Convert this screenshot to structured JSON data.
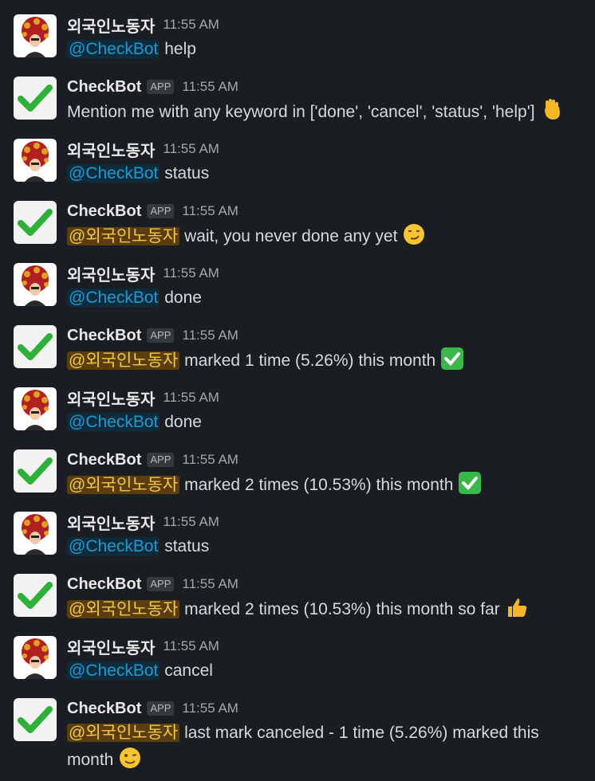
{
  "user_name": "외국인노동자",
  "bot_name": "CheckBot",
  "app_badge": "APP",
  "messages": [
    {
      "sender": "외국인노동자",
      "time": "11:55 AM",
      "mention": "@CheckBot",
      "text": " help",
      "emoji": ""
    },
    {
      "sender": "CheckBot",
      "time": "11:55 AM",
      "mention": "",
      "text": "Mention me with any keyword in ['done', 'cancel', 'status', 'help']",
      "emoji": "waving-hand-icon"
    },
    {
      "sender": "외국인노동자",
      "time": "11:55 AM",
      "mention": "@CheckBot",
      "text": " status",
      "emoji": ""
    },
    {
      "sender": "CheckBot",
      "time": "11:55 AM",
      "mention": "@외국인노동자",
      "text": " wait, you never done any yet",
      "emoji": "smirking-face-icon"
    },
    {
      "sender": "외국인노동자",
      "time": "11:55 AM",
      "mention": "@CheckBot",
      "text": " done",
      "emoji": ""
    },
    {
      "sender": "CheckBot",
      "time": "11:55 AM",
      "mention": "@외국인노동자",
      "text": " marked 1 time (5.26%) this month",
      "emoji": "check-mark-button-icon"
    },
    {
      "sender": "외국인노동자",
      "time": "11:55 AM",
      "mention": "@CheckBot",
      "text": " done",
      "emoji": ""
    },
    {
      "sender": "CheckBot",
      "time": "11:55 AM",
      "mention": "@외국인노동자",
      "text": " marked 2 times (10.53%) this month",
      "emoji": "check-mark-button-icon"
    },
    {
      "sender": "외국인노동자",
      "time": "11:55 AM",
      "mention": "@CheckBot",
      "text": " status",
      "emoji": ""
    },
    {
      "sender": "CheckBot",
      "time": "11:55 AM",
      "mention": "@외국인노동자",
      "text": " marked 2 times (10.53%) this month so far",
      "emoji": "thumbs-up-icon"
    },
    {
      "sender": "외국인노동자",
      "time": "11:55 AM",
      "mention": "@CheckBot",
      "text": " cancel",
      "emoji": ""
    },
    {
      "sender": "CheckBot",
      "time": "11:55 AM",
      "mention": "@외국인노동자",
      "text": " last mark canceled - 1 time (5.26%) marked this month",
      "emoji": "winking-face-icon"
    }
  ],
  "colors": {
    "background": "#1a1d21",
    "bot_mention": "#1d9bd1",
    "user_mention": "#f2c744",
    "check_green": "#3ba55c"
  }
}
